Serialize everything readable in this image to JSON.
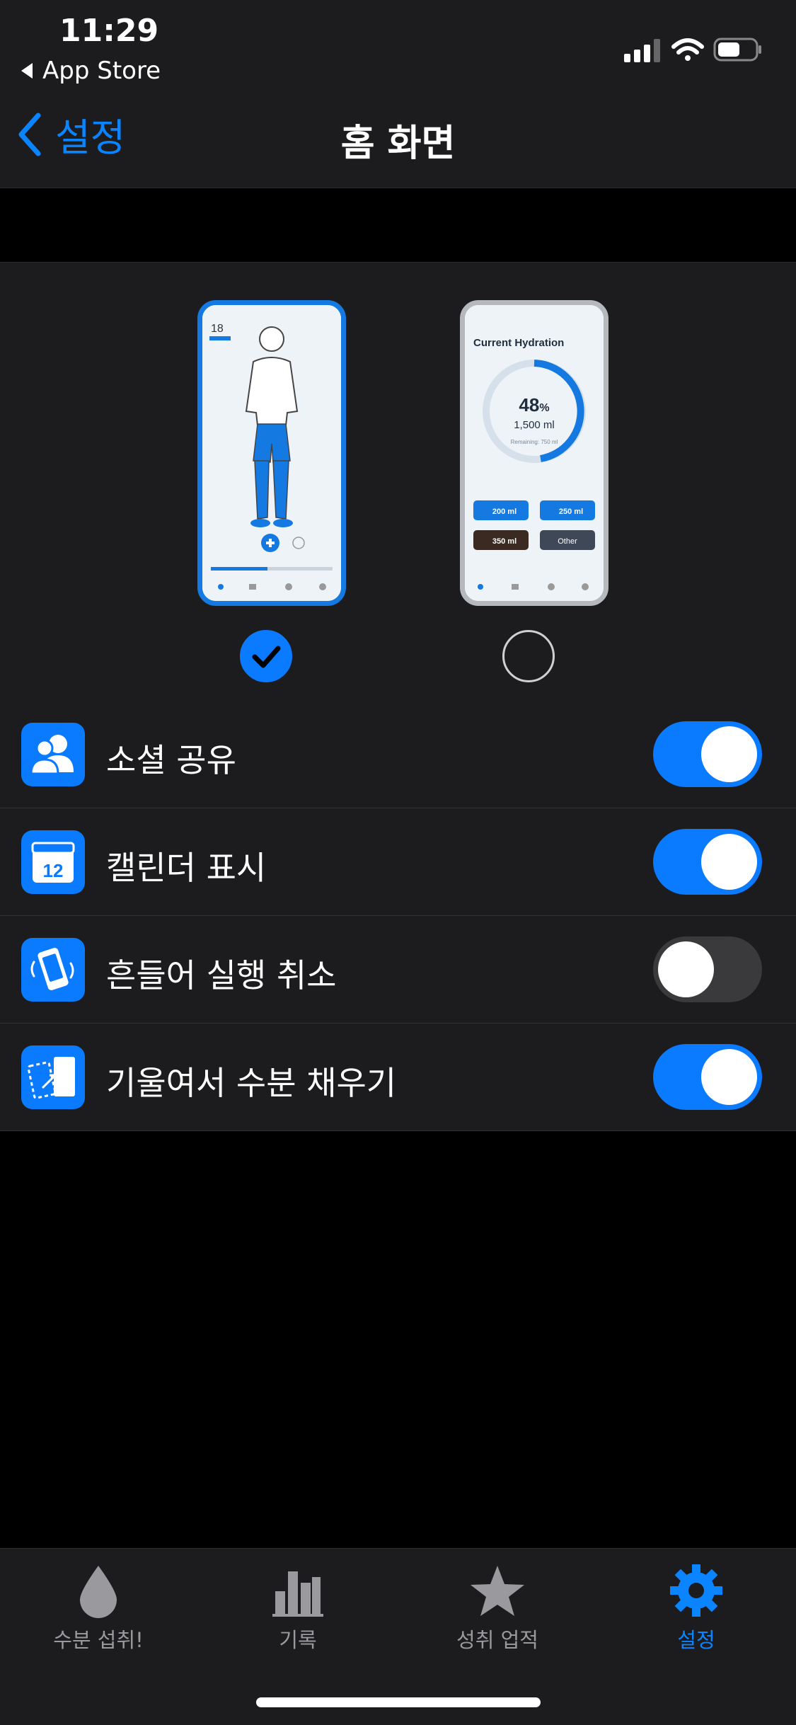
{
  "status_bar": {
    "time": "11:29",
    "back_app": "App Store"
  },
  "nav": {
    "back_label": "설정",
    "title": "홈 화면"
  },
  "previews": {
    "option1": {
      "selected": true,
      "date": "18"
    },
    "option2": {
      "selected": false,
      "title": "Current Hydration",
      "percent": "48",
      "percent_sign": "%",
      "volume": "1,500 ml",
      "remaining": "Remaining: 750 ml",
      "buttons": [
        "200 ml",
        "250 ml",
        "350 ml",
        "Other"
      ]
    }
  },
  "settings": [
    {
      "label": "소셜 공유",
      "icon": "people-icon",
      "on": true
    },
    {
      "label": "캘린더 표시",
      "icon": "calendar-icon",
      "on": true
    },
    {
      "label": "흔들어 실행 취소",
      "icon": "shake-phone-icon",
      "on": false
    },
    {
      "label": "기울여서 수분 채우기",
      "icon": "tilt-fill-icon",
      "on": true
    }
  ],
  "calendar_icon_day": "12",
  "tabs": [
    {
      "label": "수분 섭취!",
      "icon": "drop-icon",
      "active": false
    },
    {
      "label": "기록",
      "icon": "bar-chart-icon",
      "active": false
    },
    {
      "label": "성취 업적",
      "icon": "star-icon",
      "active": false
    },
    {
      "label": "설정",
      "icon": "gear-icon",
      "active": true
    }
  ],
  "colors": {
    "accent": "#0a84ff",
    "background": "#000000",
    "surface": "#1c1c1e"
  }
}
